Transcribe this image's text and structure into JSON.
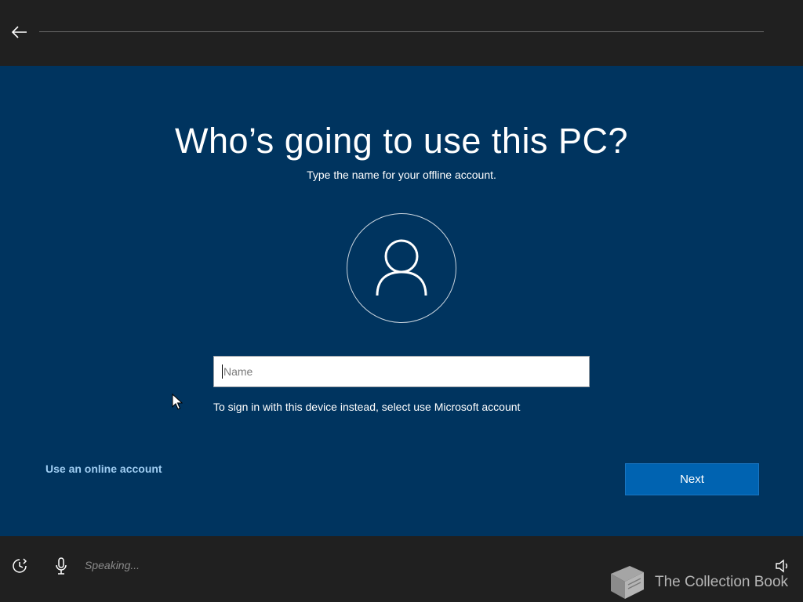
{
  "header": {
    "back_icon": "back-arrow-icon"
  },
  "main": {
    "title": "Who’s going to use this PC?",
    "subtitle": "Type the name for your offline account.",
    "avatar_icon": "user-icon",
    "name_input": {
      "placeholder": "Name",
      "value": ""
    },
    "hint": "To sign in with this device instead, select use Microsoft account",
    "online_account_link": "Use an online account",
    "next_label": "Next"
  },
  "footer": {
    "ease_icon": "ease-of-access-icon",
    "mic_icon": "microphone-icon",
    "speaking_text": "Speaking...",
    "volume_icon": "volume-icon",
    "watermark_text": "The Collection Book"
  },
  "colors": {
    "background": "#00345f",
    "bar": "#202020",
    "accent": "#0063b1",
    "link": "#9fcdf2"
  }
}
